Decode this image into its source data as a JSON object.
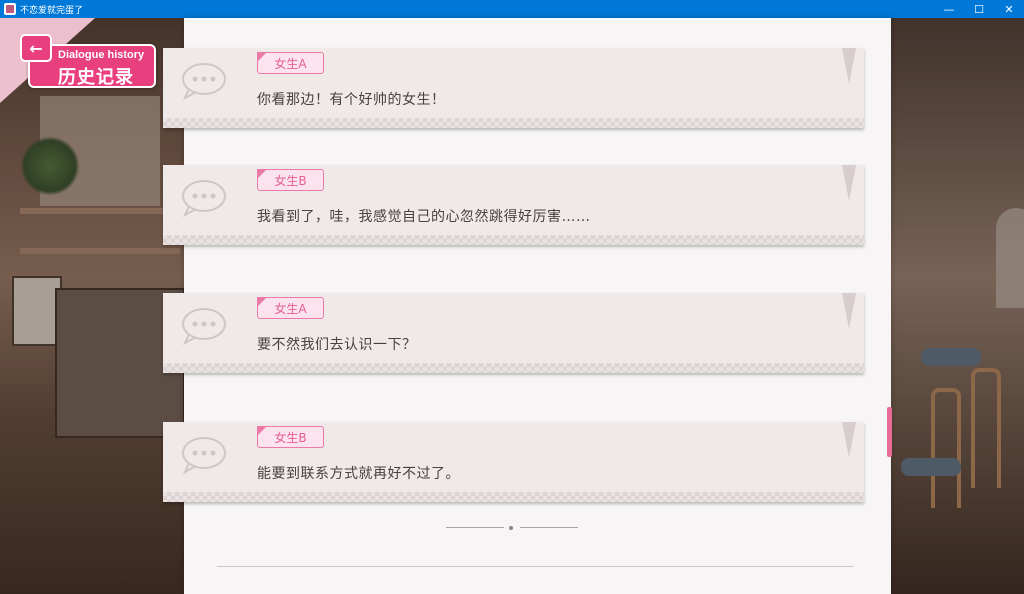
{
  "window": {
    "title": "不恋爱就完蛋了",
    "controls": {
      "minimize": "—",
      "maximize": "☐",
      "close": "✕"
    }
  },
  "header": {
    "back_icon": "←",
    "title_en": "Dialogue history",
    "title_zh": "历史记录"
  },
  "dialogues": [
    {
      "speaker": "女生A",
      "text": "你看那边！有个好帅的女生！"
    },
    {
      "speaker": "女生B",
      "text": "我看到了，哇，我感觉自己的心忽然跳得好厉害……"
    },
    {
      "speaker": "女生A",
      "text": "要不然我们去认识一下？"
    },
    {
      "speaker": "女生B",
      "text": "能要到联系方式就再好不过了。"
    }
  ],
  "colors": {
    "accent": "#e8407e",
    "name_tag_border": "#ec7aa6",
    "card_bg": "#efe9e8",
    "panel_bg": "#f7f5f5",
    "titlebar": "#0078d7"
  }
}
